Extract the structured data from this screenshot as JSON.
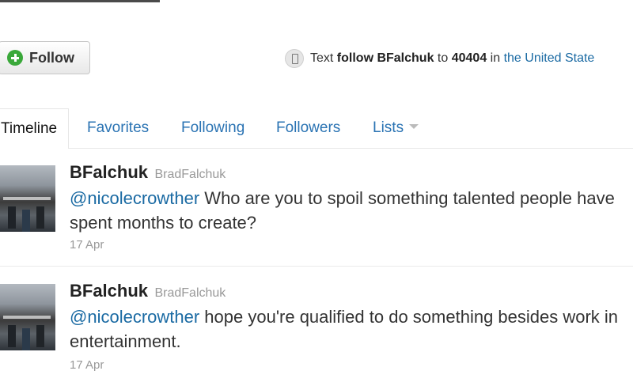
{
  "profile": {
    "follow_label": "Follow",
    "sms": {
      "prefix": "Text",
      "command": "follow BFalchuk",
      "to_word": "to",
      "number": "40404",
      "in_word": "in",
      "country_link": "the United State"
    }
  },
  "tabs": [
    {
      "label": "Timeline",
      "active": true
    },
    {
      "label": "Favorites",
      "active": false
    },
    {
      "label": "Following",
      "active": false
    },
    {
      "label": "Followers",
      "active": false
    },
    {
      "label": "Lists",
      "active": false
    }
  ],
  "tweets": [
    {
      "name": "BFalchuk",
      "handle": "BradFalchuk",
      "mention": "@nicolecrowther",
      "text": " Who are you to spoil something talented people have spent months to create?",
      "time": "17 Apr"
    },
    {
      "name": "BFalchuk",
      "handle": "BradFalchuk",
      "mention": "@nicolecrowther",
      "text": " hope you're qualified to do something besides work in entertainment.",
      "time": "17 Apr"
    }
  ],
  "colors": {
    "link": "#1a6aa3",
    "tab_link": "#2a73b3",
    "follow_icon": "#3aa83a",
    "muted": "#999999"
  }
}
